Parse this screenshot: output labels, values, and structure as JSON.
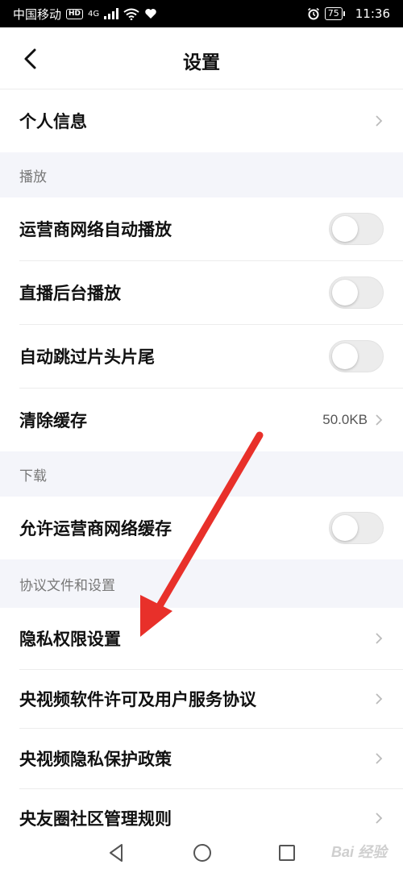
{
  "status_bar": {
    "carrier": "中国移动",
    "hd": "HD",
    "network": "4G",
    "battery": "75",
    "time": "11:36"
  },
  "header": {
    "title": "设置",
    "back_icon": "chevron-left-icon"
  },
  "rows": {
    "profile": {
      "label": "个人信息"
    },
    "section_play": "播放",
    "carrier_autoplay": {
      "label": "运营商网络自动播放",
      "on": false
    },
    "live_background": {
      "label": "直播后台播放",
      "on": false
    },
    "skip_intro": {
      "label": "自动跳过片头片尾",
      "on": false
    },
    "clear_cache": {
      "label": "清除缓存",
      "value": "50.0KB"
    },
    "section_download": "下载",
    "carrier_cache": {
      "label": "允许运营商网络缓存",
      "on": false
    },
    "section_agreements": "协议文件和设置",
    "privacy_permissions": {
      "label": "隐私权限设置"
    },
    "license": {
      "label": "央视频软件许可及用户服务协议"
    },
    "privacy_policy": {
      "label": "央视频隐私保护政策"
    },
    "community_rules": {
      "label": "央友圈社区管理规则"
    }
  },
  "watermark": "Bai 经验",
  "colors": {
    "section_bg": "#f4f5fa",
    "toggle_off": "#ececec",
    "annotation_arrow": "#e8302a"
  }
}
